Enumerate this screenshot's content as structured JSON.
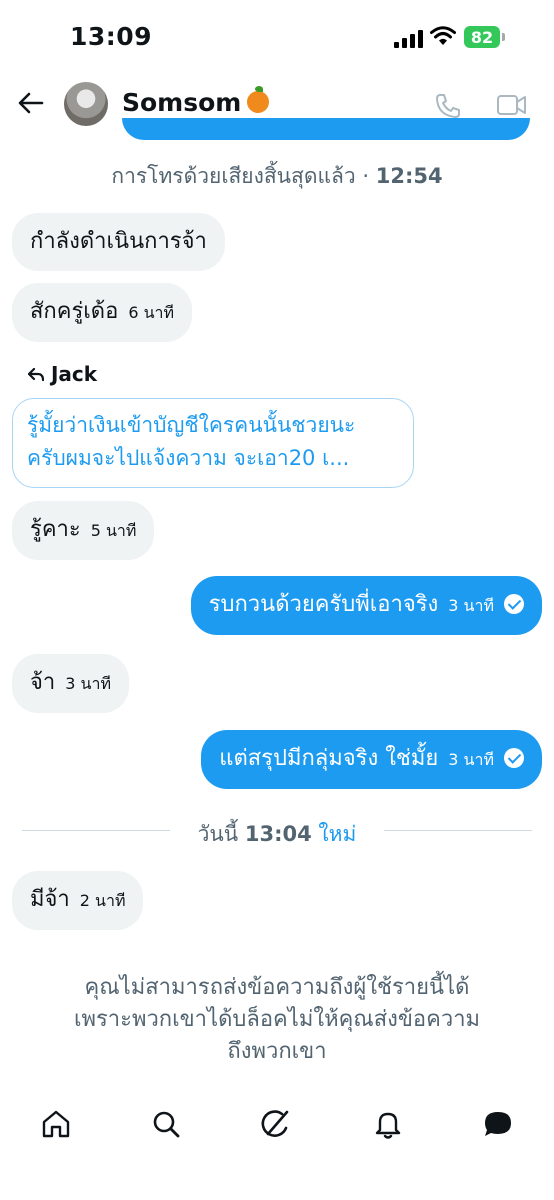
{
  "status_bar": {
    "time": "13:09",
    "battery": "82"
  },
  "header": {
    "contact_name": "Somsom"
  },
  "call_notice": {
    "text": "การโทรด้วยเสียงสิ้นสุดแล้ว",
    "time": "12:54"
  },
  "messages": [
    {
      "text": "กำลังดำเนินการจ้า",
      "time": ""
    },
    {
      "text": "สักครู่เด้อ",
      "time": "6 นาที"
    },
    {
      "text": "รู้คาะ",
      "time": "5 นาที"
    },
    {
      "text": "รบกวนด้วยครับพี่เอาจริง",
      "time": "3 นาที"
    },
    {
      "text": "จ้า",
      "time": "3 นาที"
    },
    {
      "text": "แต่สรุปมีกลุ่มจริง ใช่มั้ย",
      "time": "3 นาที"
    },
    {
      "text": "มีจ้า",
      "time": "2 นาที"
    }
  ],
  "reply": {
    "to": "Jack",
    "line1": "รู้มั้ยว่าเงินเข้าบัญชีใครคนนั้นชวยนะ",
    "line2": "ครับผมจะไปแจ้งความ จะเอา20 เ..."
  },
  "new_divider": {
    "today": "วันนี้",
    "time": "13:04",
    "new_label": "ใหม่"
  },
  "blocked_notice": {
    "line1": "คุณไม่สามารถส่งข้อความถึงผู้ใช้รายนี้ได้",
    "line2": "เพราะพวกเขาได้บล็อคไม่ให้คุณส่งข้อความ",
    "line3": "ถึงพวกเขา"
  },
  "colors": {
    "accent": "#1d9bf0",
    "incoming_bg": "#eff3f4",
    "muted_text": "#536471"
  },
  "nav_icons": [
    "home-icon",
    "search-icon",
    "grok-icon",
    "bell-icon",
    "messages-icon"
  ]
}
